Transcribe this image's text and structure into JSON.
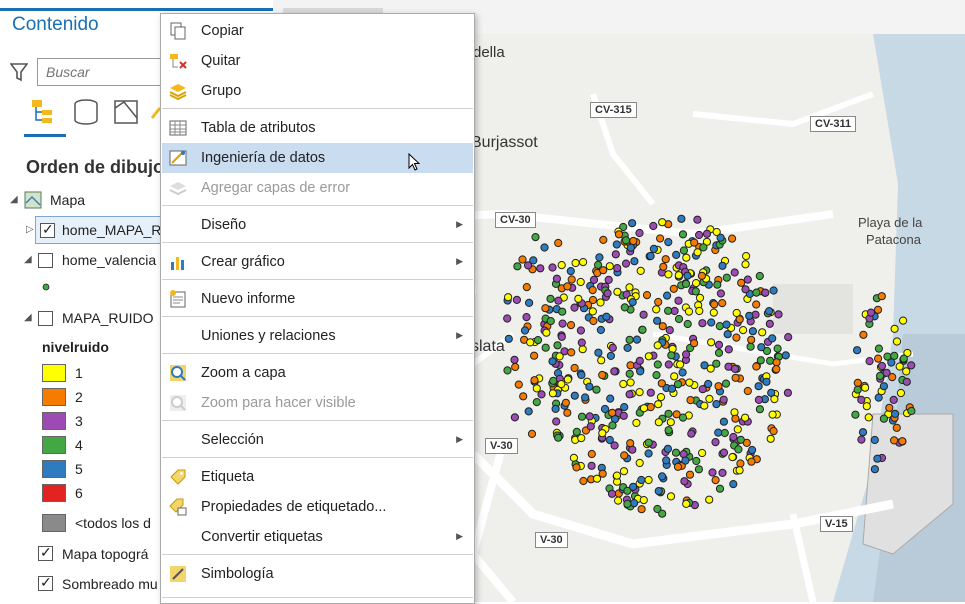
{
  "pane": {
    "title": "Contenido",
    "search_placeholder": "Buscar",
    "draw_order": "Orden de dibujo",
    "tree": {
      "map": "Mapa",
      "layer1": "home_MAPA_R",
      "layer2": "home_valencia",
      "layer3": "MAPA_RUIDO",
      "field": "nivelruido",
      "legend": [
        {
          "label": "1",
          "color": "#ffff00"
        },
        {
          "label": "2",
          "color": "#f57c00"
        },
        {
          "label": "3",
          "color": "#9b4bb3"
        },
        {
          "label": "4",
          "color": "#43a843"
        },
        {
          "label": "5",
          "color": "#2f7bc0"
        },
        {
          "label": "6",
          "color": "#e32222"
        },
        {
          "label": "<todos los d",
          "color": "#8a8a8a"
        }
      ],
      "basemap1": "Mapa topográ",
      "basemap2": "Sombreado mu"
    }
  },
  "map": {
    "labels": {
      "della": "della",
      "burjassot": "Burjassot",
      "playa": "Playa de la",
      "patacona": "Patacona",
      "slata": "slata"
    },
    "shields": [
      "CV-315",
      "CV-311",
      "CV-30",
      "V-30",
      "V-15",
      "V-30"
    ]
  },
  "menu": {
    "items": {
      "copiar": "Copiar",
      "quitar": "Quitar",
      "grupo": "Grupo",
      "tabla": "Tabla de atributos",
      "ingenieria": "Ingeniería de datos",
      "agregar": "Agregar capas de error",
      "diseno": "Diseño",
      "grafico": "Crear gráfico",
      "informe": "Nuevo informe",
      "uniones": "Uniones y relaciones",
      "zoomcapa": "Zoom a capa",
      "zoomvisible": "Zoom para hacer visible",
      "seleccion": "Selección",
      "etiqueta": "Etiqueta",
      "propiedades": "Propiedades de etiquetado...",
      "convertir": "Convertir etiquetas",
      "simbologia": "Simbología"
    }
  }
}
